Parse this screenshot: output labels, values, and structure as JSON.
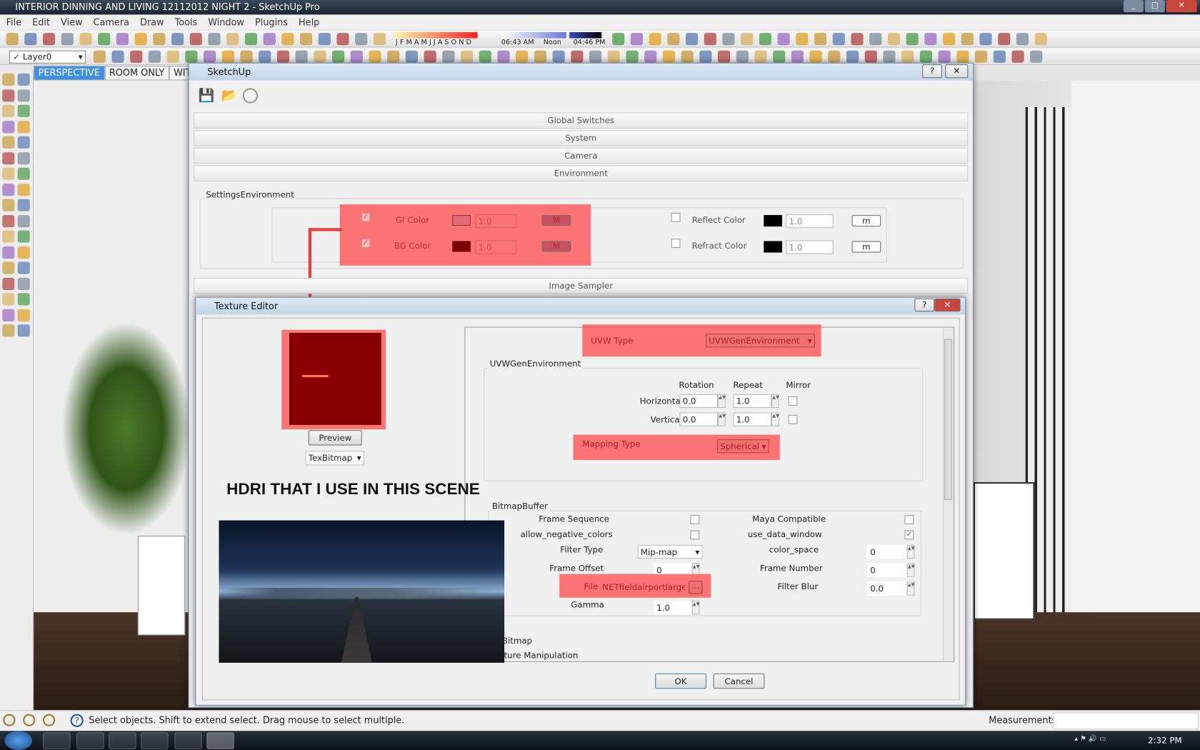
{
  "app": {
    "title": "INTERIOR DINNING AND LIVING 12112012 NIGHT 2 - SketchUp Pro"
  },
  "menu": [
    "File",
    "Edit",
    "View",
    "Camera",
    "Draw",
    "Tools",
    "Window",
    "Plugins",
    "Help"
  ],
  "toolbar": {
    "layer": "Layer0",
    "months": "J F M A M J J A S O N D",
    "time_start": "06:43 AM",
    "time_noon": "Noon",
    "time_end": "04:46 PM"
  },
  "scenes": [
    "PERSPECTIVE",
    "ROOM ONLY",
    "WITHOU"
  ],
  "vray_dialog": {
    "title": "SketchUp",
    "sections": [
      "Global Switches",
      "System",
      "Camera",
      "Environment"
    ],
    "group": "SettingsEnvironment",
    "gi": {
      "label": "GI Color",
      "value": "1.0",
      "btn": "M",
      "swatch": "#e06a78"
    },
    "bg": {
      "label": "BG Color",
      "value": "1.0",
      "btn": "M",
      "swatch": "#7a0000"
    },
    "reflect": {
      "label": "Reflect Color",
      "value": "1.0",
      "btn": "m"
    },
    "refract": {
      "label": "Refract Color",
      "value": "1.0",
      "btn": "m"
    },
    "image_sampler": "Image Sampler"
  },
  "texture_editor": {
    "title": "Texture Editor",
    "preview_btn": "Preview",
    "type": "TexBitmap",
    "uvw_type_label": "UVW Type",
    "uvw_type": "UVWGenEnvironment",
    "uvw_group": "UVWGenEnvironment",
    "col_rotation": "Rotation",
    "col_repeat": "Repeat",
    "col_mirror": "Mirror",
    "horizontal": {
      "label": "Horizontal",
      "rotation": "0.0",
      "repeat": "1.0",
      "mirror": false
    },
    "vertical": {
      "label": "Vertical",
      "rotation": "0.0",
      "repeat": "1.0",
      "mirror": false
    },
    "mapping_label": "Mapping Type",
    "mapping": "Spherical",
    "bitmap_group": "BitmapBuffer",
    "frame_sequence": "Frame Sequence",
    "allow_negative": "allow_negative_colors",
    "filter_type_label": "Filter Type",
    "filter_type": "Mip-map",
    "frame_offset_label": "Frame Offset",
    "frame_offset": "0",
    "file_label": "File",
    "file": "NETfieldairportlarge.hdr",
    "browse": "...",
    "gamma_label": "Gamma",
    "gamma": "1.0",
    "maya": "Maya Compatible",
    "use_data_window": "use_data_window",
    "color_space_label": "color_space",
    "color_space": "0",
    "frame_number_label": "Frame Number",
    "frame_number": "0",
    "filter_blur_label": "Filter Blur",
    "filter_blur": "0.0",
    "bitmap": "Bitmap",
    "texture_manip": "xture Manipulation",
    "ok": "OK",
    "cancel": "Cancel"
  },
  "annotation": "HDRI THAT I USE IN THIS SCENE",
  "status": {
    "text": "Select objects. Shift to extend select. Drag mouse to select multiple.",
    "measurements": "Measurements"
  },
  "taskbar": {
    "clock": "2:32 PM"
  },
  "colors": {
    "highlight": "#ff5050",
    "selected_tab": "#3d8fe0"
  }
}
